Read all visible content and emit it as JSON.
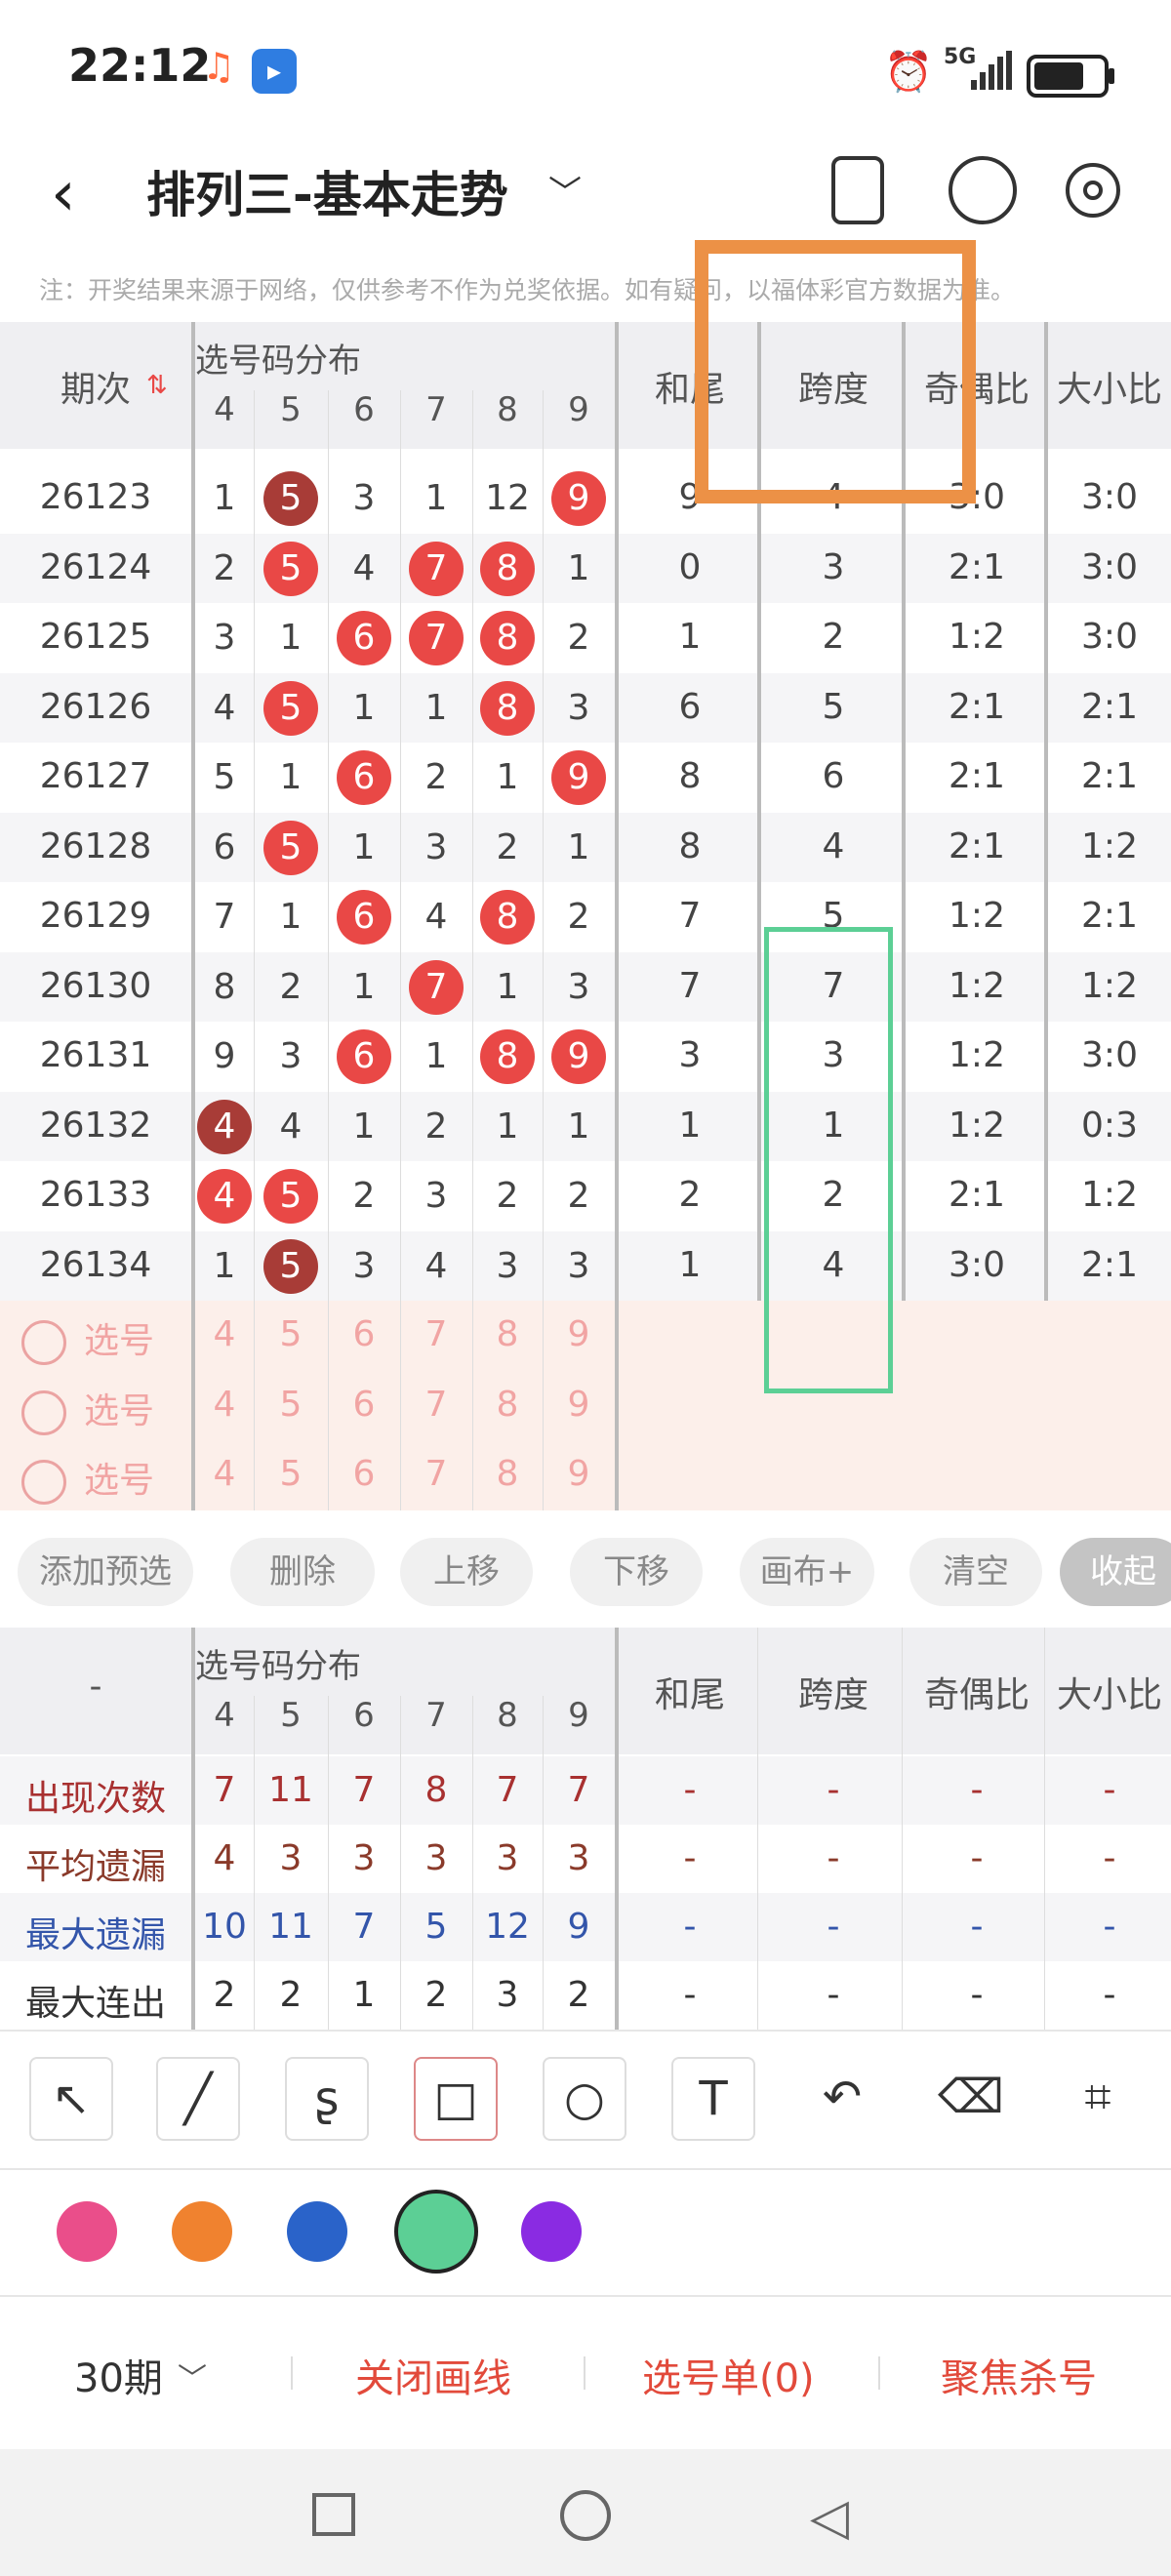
{
  "status_bar": {
    "time": "22:12",
    "network": "5G"
  },
  "header": {
    "title": "排列三-基本走势"
  },
  "notice": "注：开奖结果来源于网络，仅供参考不作为兑奖依据。如有疑问，以福体彩官方数据为准。",
  "table": {
    "period_header": "期次",
    "dist_header": "选号码分布",
    "digit_headers": [
      "4",
      "5",
      "6",
      "7",
      "8",
      "9"
    ],
    "stat_headers": [
      "和尾",
      "跨度",
      "奇偶比",
      "大小比"
    ],
    "rows": [
      {
        "period": "26123",
        "d": [
          "1",
          "5",
          "3",
          "1",
          "12",
          "9"
        ],
        "balls": [
          null,
          "dark",
          null,
          null,
          null,
          "red"
        ],
        "s": [
          "9",
          "4",
          "3:0",
          "3:0"
        ]
      },
      {
        "period": "26124",
        "d": [
          "2",
          "5",
          "4",
          "7",
          "8",
          "1"
        ],
        "balls": [
          null,
          "red",
          null,
          "red",
          "red",
          null
        ],
        "s": [
          "0",
          "3",
          "2:1",
          "3:0"
        ]
      },
      {
        "period": "26125",
        "d": [
          "3",
          "1",
          "6",
          "7",
          "8",
          "2"
        ],
        "balls": [
          null,
          null,
          "red",
          "red",
          "red",
          null
        ],
        "s": [
          "1",
          "2",
          "1:2",
          "3:0"
        ]
      },
      {
        "period": "26126",
        "d": [
          "4",
          "5",
          "1",
          "1",
          "8",
          "3"
        ],
        "balls": [
          null,
          "red",
          null,
          null,
          "red",
          null
        ],
        "s": [
          "6",
          "5",
          "2:1",
          "2:1"
        ]
      },
      {
        "period": "26127",
        "d": [
          "5",
          "1",
          "6",
          "2",
          "1",
          "9"
        ],
        "balls": [
          null,
          null,
          "red",
          null,
          null,
          "red"
        ],
        "s": [
          "8",
          "6",
          "2:1",
          "2:1"
        ]
      },
      {
        "period": "26128",
        "d": [
          "6",
          "5",
          "1",
          "3",
          "2",
          "1"
        ],
        "balls": [
          null,
          "red",
          null,
          null,
          null,
          null
        ],
        "s": [
          "8",
          "4",
          "2:1",
          "1:2"
        ]
      },
      {
        "period": "26129",
        "d": [
          "7",
          "1",
          "6",
          "4",
          "8",
          "2"
        ],
        "balls": [
          null,
          null,
          "red",
          null,
          "red",
          null
        ],
        "s": [
          "7",
          "5",
          "1:2",
          "2:1"
        ]
      },
      {
        "period": "26130",
        "d": [
          "8",
          "2",
          "1",
          "7",
          "1",
          "3"
        ],
        "balls": [
          null,
          null,
          null,
          "red",
          null,
          null
        ],
        "s": [
          "7",
          "7",
          "1:2",
          "1:2"
        ]
      },
      {
        "period": "26131",
        "d": [
          "9",
          "3",
          "6",
          "1",
          "8",
          "9"
        ],
        "balls": [
          null,
          null,
          "red",
          null,
          "red",
          "red"
        ],
        "s": [
          "3",
          "3",
          "1:2",
          "3:0"
        ]
      },
      {
        "period": "26132",
        "d": [
          "4",
          "4",
          "1",
          "2",
          "1",
          "1"
        ],
        "balls": [
          "dark",
          null,
          null,
          null,
          null,
          null
        ],
        "s": [
          "1",
          "1",
          "1:2",
          "0:3"
        ]
      },
      {
        "period": "26133",
        "d": [
          "4",
          "5",
          "2",
          "3",
          "2",
          "2"
        ],
        "balls": [
          "red",
          "red",
          null,
          null,
          null,
          null
        ],
        "s": [
          "2",
          "2",
          "2:1",
          "1:2"
        ]
      },
      {
        "period": "26134",
        "d": [
          "1",
          "5",
          "3",
          "4",
          "3",
          "3"
        ],
        "balls": [
          null,
          "dark",
          null,
          null,
          null,
          null
        ],
        "s": [
          "1",
          "4",
          "3:0",
          "2:1"
        ]
      }
    ],
    "pick_label": "选号",
    "pick_digits": [
      "4",
      "5",
      "6",
      "7",
      "8",
      "9"
    ]
  },
  "buttons": [
    "添加预选",
    "删除",
    "上移",
    "下移",
    "画布+",
    "清空",
    "收起"
  ],
  "stats": {
    "corner": "-",
    "rows": [
      {
        "label": "出现次数",
        "color": "#a83030",
        "v": [
          "7",
          "11",
          "7",
          "8",
          "7",
          "7"
        ],
        "s": [
          "-",
          "-",
          "-",
          "-"
        ]
      },
      {
        "label": "平均遗漏",
        "color": "#8a3a2a",
        "v": [
          "4",
          "3",
          "3",
          "3",
          "3",
          "3"
        ],
        "s": [
          "-",
          "-",
          "-",
          "-"
        ]
      },
      {
        "label": "最大遗漏",
        "color": "#3355aa",
        "v": [
          "10",
          "11",
          "7",
          "5",
          "12",
          "9"
        ],
        "s": [
          "-",
          "-",
          "-",
          "-"
        ]
      },
      {
        "label": "最大连出",
        "color": "#333333",
        "v": [
          "2",
          "2",
          "1",
          "2",
          "3",
          "2"
        ],
        "s": [
          "-",
          "-",
          "-",
          "-"
        ]
      }
    ]
  },
  "tools": [
    "arrow-tool-icon",
    "line-tool-icon",
    "curve-tool-icon",
    "rectangle-tool-icon",
    "circle-tool-icon",
    "text-tool-icon",
    "undo-icon",
    "eraser-icon",
    "clear-brush-icon"
  ],
  "colors": [
    "#ea4e8a",
    "#f0822f",
    "#2a63c9",
    "#5ccf95",
    "#8a2be2"
  ],
  "bottom": {
    "period_select": "30期",
    "close_draw": "关闭画线",
    "pick_list": "选号单(0)",
    "focus_kill": "聚焦杀号"
  },
  "accent": "#e24a3b"
}
